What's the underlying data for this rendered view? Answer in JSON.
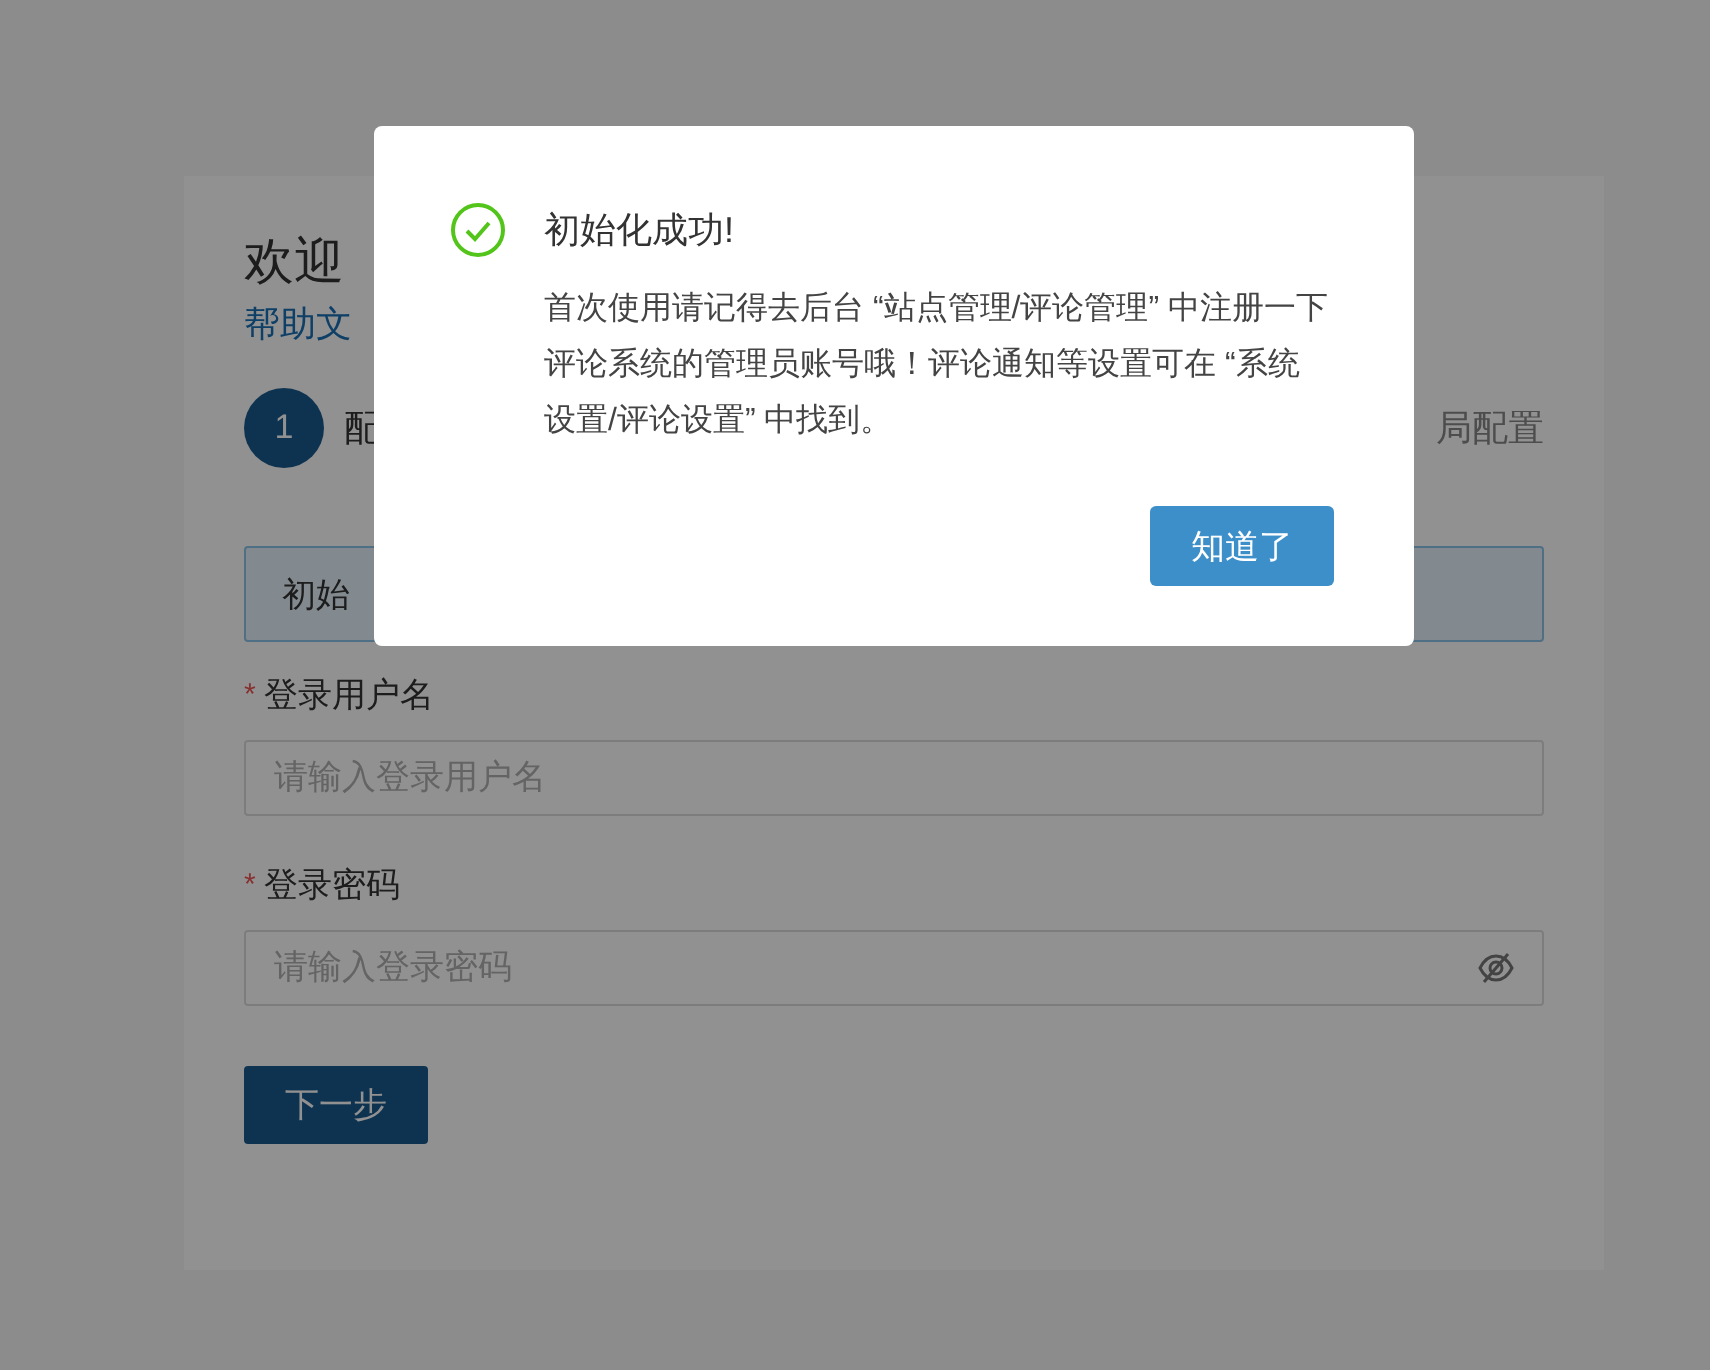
{
  "page": {
    "title": "欢迎",
    "help_link": "帮助文",
    "steps": [
      {
        "number": "1",
        "label": "配",
        "selected": true
      },
      {
        "label": "局配置",
        "selected": false
      }
    ],
    "alert": {
      "text": "初始"
    },
    "fields": [
      {
        "required_mark": "*",
        "label": "登录用户名",
        "placeholder": "请输入登录用户名",
        "kind": "text"
      },
      {
        "required_mark": "*",
        "label": "登录密码",
        "placeholder": "请输入登录密码",
        "kind": "password"
      }
    ],
    "next_button": "下一步"
  },
  "dialog": {
    "title": "初始化成功!",
    "message": "首次使用请记得去后台 “站点管理/评论管理” 中注册一下评论系统的管理员账号哦！评论通知等设置可在 “系统设置/评论设置” 中找到。",
    "button": "知道了"
  }
}
